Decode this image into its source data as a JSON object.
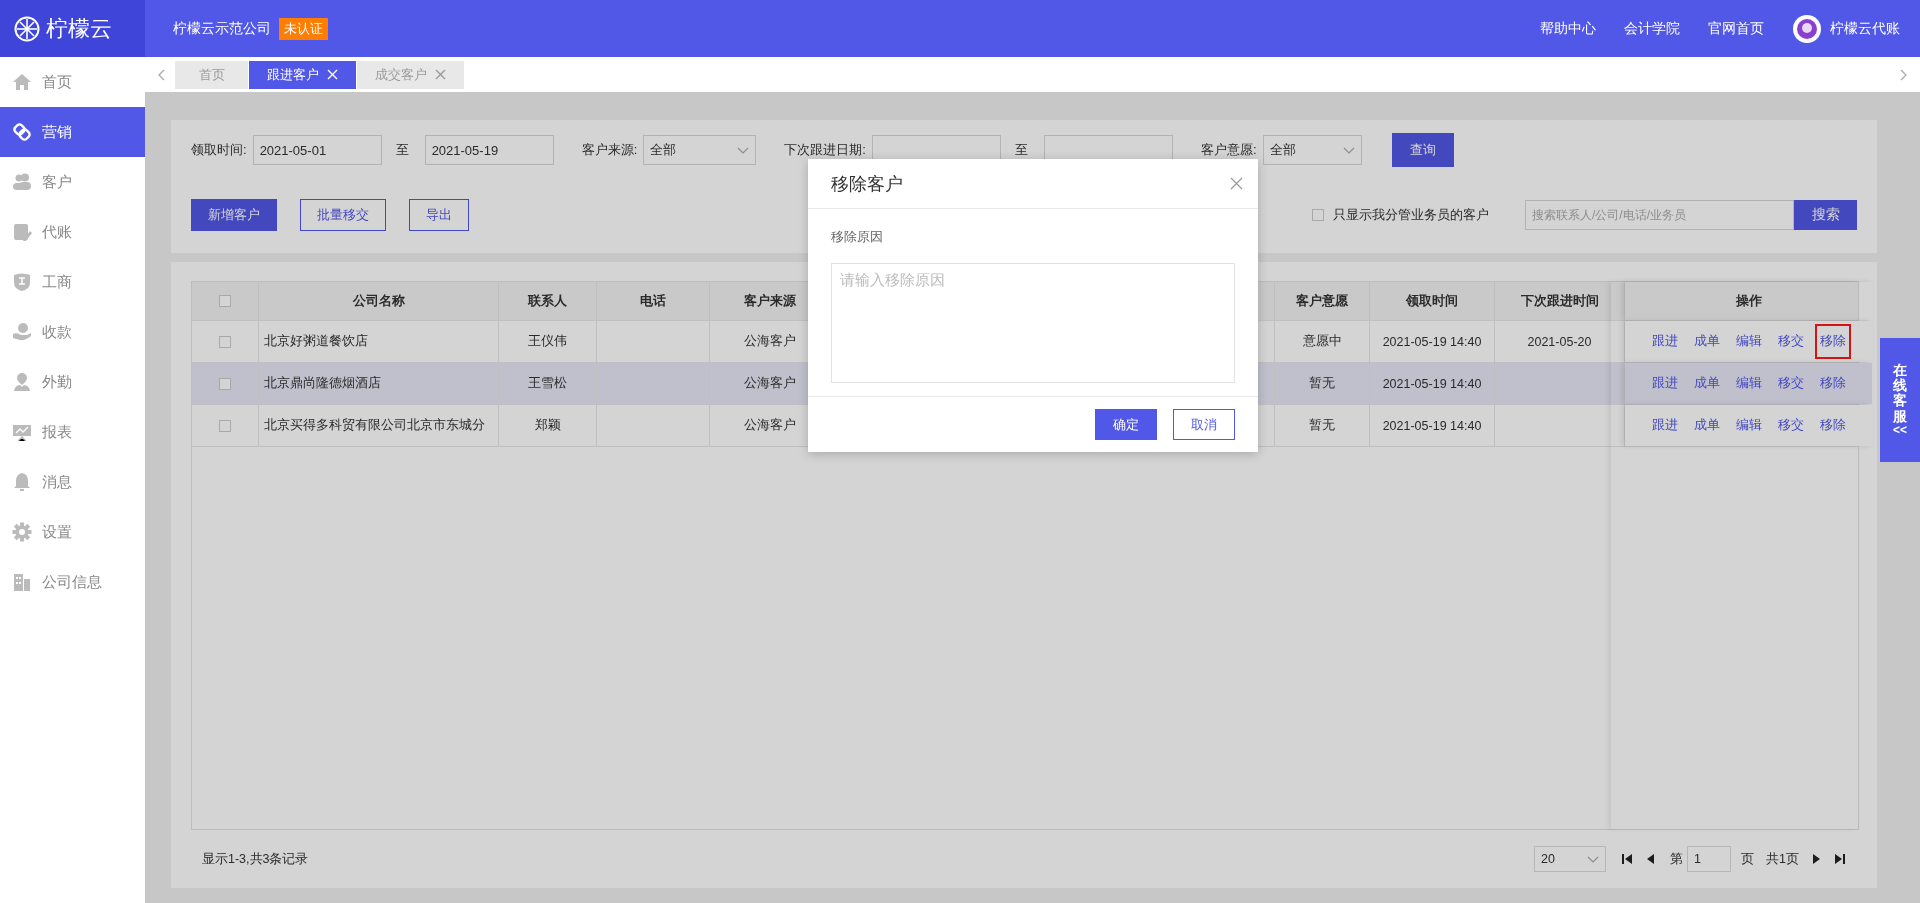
{
  "header": {
    "logo": "柠檬云",
    "company": "柠檬云示范公司",
    "badge": "未认证",
    "links": [
      "帮助中心",
      "会计学院",
      "官网首页"
    ],
    "user": "柠檬云代账"
  },
  "sidebar": {
    "items": [
      {
        "label": "首页",
        "selected": false
      },
      {
        "label": "营销",
        "selected": true
      },
      {
        "label": "客户",
        "selected": false
      },
      {
        "label": "代账",
        "selected": false
      },
      {
        "label": "工商",
        "selected": false
      },
      {
        "label": "收款",
        "selected": false
      },
      {
        "label": "外勤",
        "selected": false
      },
      {
        "label": "报表",
        "selected": false
      },
      {
        "label": "消息",
        "selected": false
      },
      {
        "label": "设置",
        "selected": false
      },
      {
        "label": "公司信息",
        "selected": false
      }
    ]
  },
  "tabs": [
    {
      "label": "首页",
      "selected": false,
      "closable": false
    },
    {
      "label": "跟进客户",
      "selected": true,
      "closable": true
    },
    {
      "label": "成交客户",
      "selected": false,
      "closable": true
    }
  ],
  "filters": [
    {
      "kind": "range",
      "label": "领取时间:",
      "from": "2021-05-01",
      "separator": "至",
      "to": "2021-05-19"
    },
    {
      "kind": "select",
      "label": "客户来源:",
      "value": "全部"
    },
    {
      "kind": "range",
      "label": "下次跟进日期:",
      "separator": "至"
    },
    {
      "kind": "select",
      "label": "客户意愿:",
      "value": "全部"
    }
  ],
  "query_button": "查询",
  "actions": [
    {
      "label": "新增客户",
      "kind": "primary"
    },
    {
      "label": "批量移交",
      "kind": "outline"
    },
    {
      "label": "导出",
      "kind": "outline"
    }
  ],
  "only_mine": {
    "label": "只显示我分管业务员的客户",
    "checked": false
  },
  "search": {
    "placeholder": "搜索联系人/公司/电话/业务员",
    "button": "搜索"
  },
  "table": {
    "select_all_checked": false,
    "columns": [
      "公司名称",
      "联系人",
      "电话",
      "客户来源",
      "客户意愿",
      "领取时间",
      "下次跟进时间",
      "操作"
    ],
    "rows": [
      {
        "checked": false,
        "highlighted": false,
        "company": "北京好粥道餐饮店",
        "contact": "王仪伟",
        "source": "公海客户",
        "intent": "意愿中",
        "received": "2021-05-19 14:40",
        "next_followup": "2021-05-20",
        "actions": [
          {
            "label": "跟进",
            "highlighted": false
          },
          {
            "label": "成单",
            "highlighted": false
          },
          {
            "label": "编辑",
            "highlighted": false
          },
          {
            "label": "移交",
            "highlighted": false
          },
          {
            "label": "移除",
            "highlighted": true
          }
        ]
      },
      {
        "checked": false,
        "highlighted": true,
        "company": "北京鼎尚隆德烟酒店",
        "contact": "王雪松",
        "source": "公海客户",
        "intent": "暂无",
        "received": "2021-05-19 14:40",
        "actions": [
          {
            "label": "跟进",
            "highlighted": false
          },
          {
            "label": "成单",
            "highlighted": false
          },
          {
            "label": "编辑",
            "highlighted": false
          },
          {
            "label": "移交",
            "highlighted": false
          },
          {
            "label": "移除",
            "highlighted": false
          }
        ]
      },
      {
        "checked": false,
        "highlighted": false,
        "company": "北京买得多科贸有限公司北京市东城分",
        "contact": "郑颖",
        "source": "公海客户",
        "intent": "暂无",
        "received": "2021-05-19 14:40",
        "actions": [
          {
            "label": "跟进",
            "highlighted": false
          },
          {
            "label": "成单",
            "highlighted": false
          },
          {
            "label": "编辑",
            "highlighted": false
          },
          {
            "label": "移交",
            "highlighted": false
          },
          {
            "label": "移除",
            "highlighted": false
          }
        ]
      }
    ]
  },
  "pagination": {
    "summary": "显示1-3,共3条记录",
    "page_size": "20",
    "page_prefix": "第",
    "page": "1",
    "page_suffix": "页",
    "total": "共1页"
  },
  "dialog": {
    "title": "移除客户",
    "field_label": "移除原因",
    "placeholder": "请输入移除原因",
    "confirm": "确定",
    "cancel": "取消"
  },
  "service_tab": {
    "label": "在线客服",
    "arrow": "<<"
  }
}
